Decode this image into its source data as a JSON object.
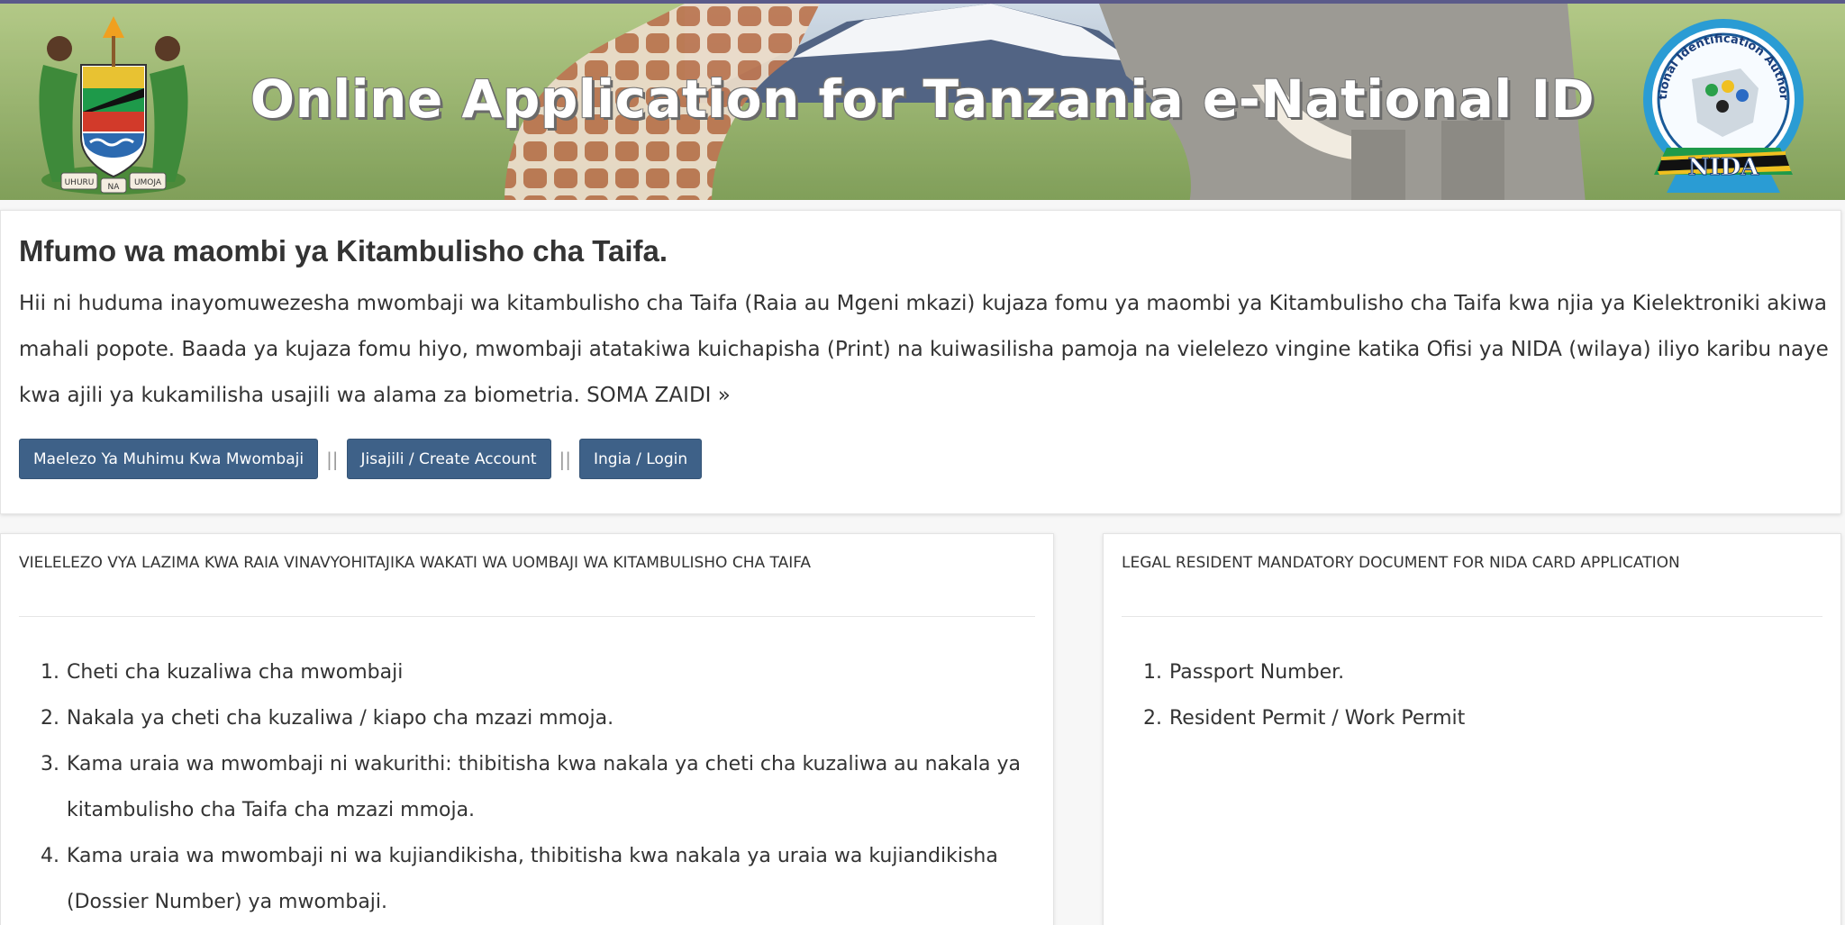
{
  "banner": {
    "title": "Online Application for Tanzania e-National ID",
    "coat_of_arms": "tanzania-coat-of-arms",
    "coat_motto": [
      "UHURU",
      "NA",
      "UMOJA"
    ],
    "logo": "nida-logo",
    "logo_ring_text": "National Identification Authority",
    "logo_band_text": "NIDA"
  },
  "intro": {
    "title": "Mfumo wa maombi ya Kitambulisho cha Taifa.",
    "text": "Hii ni huduma inayomuwezesha mwombaji wa kitambulisho cha Taifa (Raia au Mgeni mkazi) kujaza fomu ya maombi ya Kitambulisho cha Taifa kwa njia ya Kielektroniki akiwa mahali popote. Baada ya kujaza fomu hiyo, mwombaji atatakiwa kuichapisha (Print) na kuiwasilisha pamoja na vielelezo vingine katika Ofisi ya NIDA (wilaya) iliyo karibu naye kwa ajili ya kukamilisha usajili wa alama za biometria.",
    "read_more": "SOMA ZAIDI »",
    "buttons": {
      "info": "Maelezo Ya Muhimu Kwa Mwombaji",
      "register": "Jisajili / Create Account",
      "login": "Ingia / Login"
    },
    "separator": "||"
  },
  "citizen_card": {
    "heading": "VIELELEZO VYA LAZIMA KWA RAIA VINAVYOHITAJIKA WAKATI WA UOMBAJI WA KITAMBULISHO CHA TAIFA",
    "items": [
      {
        "num": "1.",
        "text": "Cheti cha kuzaliwa cha mwombaji"
      },
      {
        "num": "2.",
        "text": "Nakala ya cheti cha kuzaliwa / kiapo cha mzazi mmoja."
      },
      {
        "num": "3.",
        "text": "Kama uraia wa mwombaji ni wakurithi: thibitisha kwa nakala ya cheti cha kuzaliwa au nakala ya kitambulisho cha Taifa cha mzazi mmoja."
      },
      {
        "num": "4.",
        "text": "Kama uraia wa mwombaji ni wa kujiandikisha, thibitisha kwa nakala ya uraia wa kujiandikisha (Dossier Number) ya mwombaji."
      }
    ]
  },
  "resident_card": {
    "heading": "LEGAL RESIDENT MANDATORY DOCUMENT FOR NIDA CARD APPLICATION",
    "items": [
      {
        "num": "1.",
        "text": "Passport Number."
      },
      {
        "num": "2.",
        "text": "Resident Permit / Work Permit"
      }
    ]
  },
  "colors": {
    "button": "#3e6188",
    "banner_border": "#5a5a8a",
    "page_bg": "#f7f7f7"
  }
}
